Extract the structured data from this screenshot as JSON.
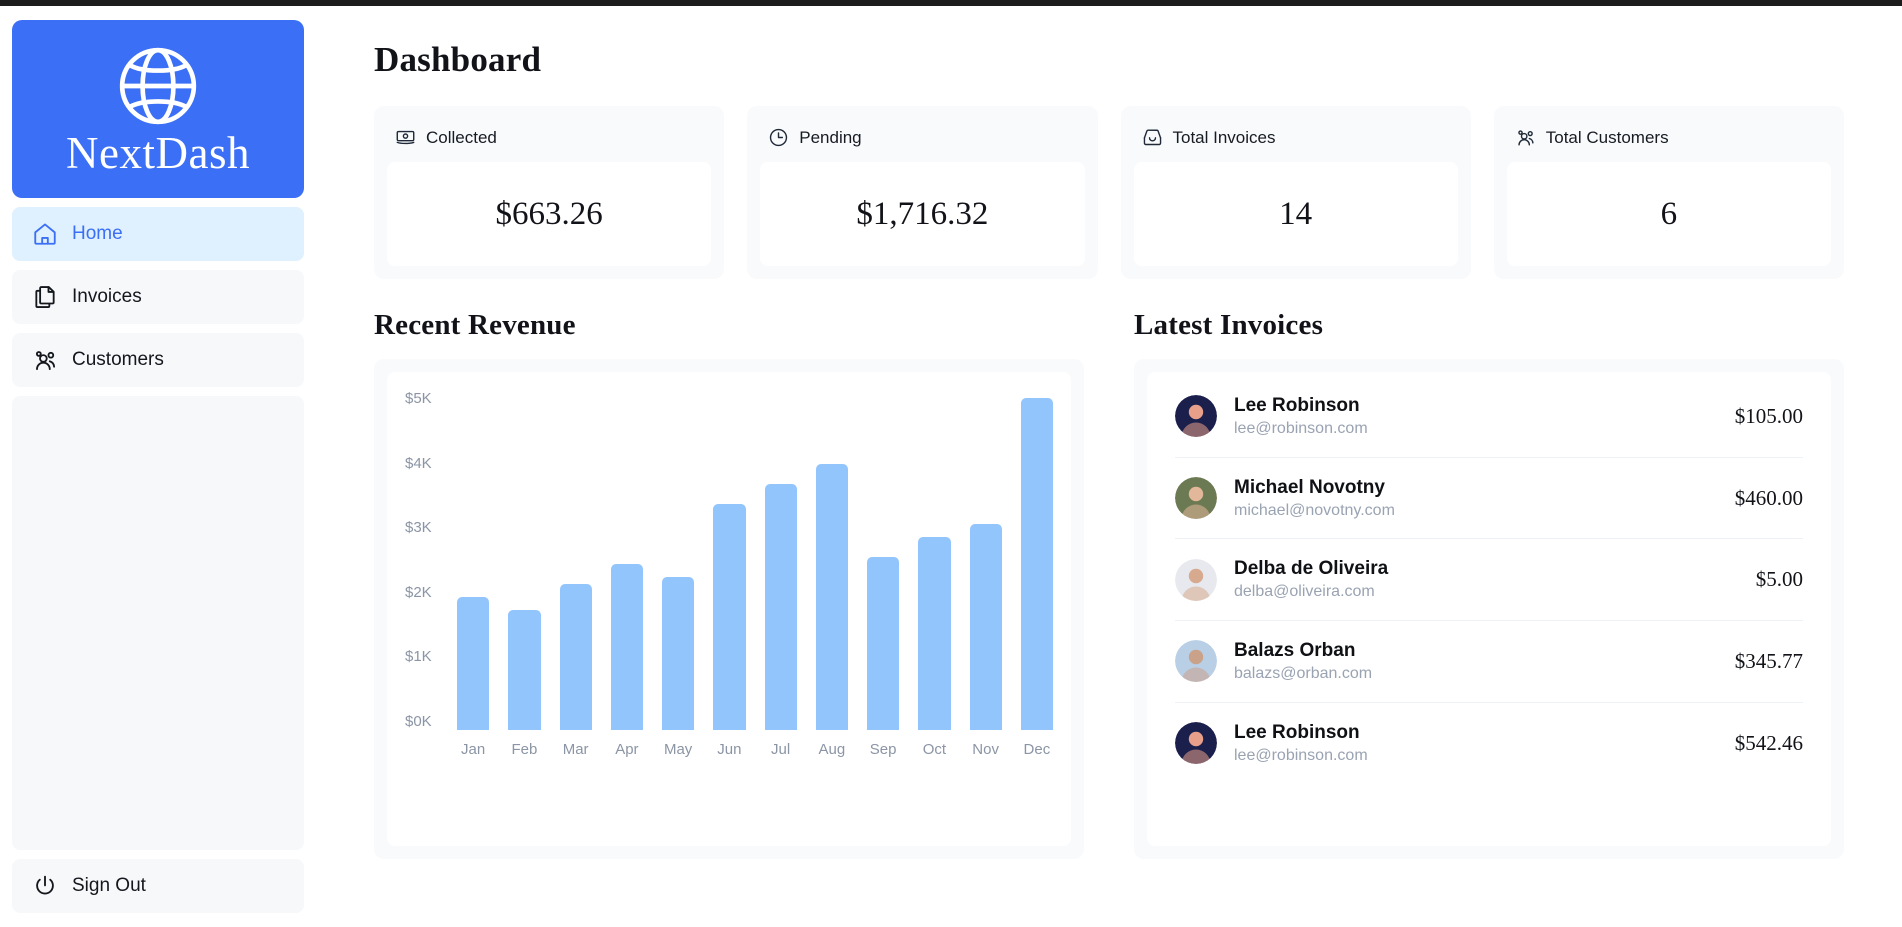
{
  "sidebar": {
    "brand": "NextDash",
    "brand_icon": "globe-icon",
    "nav": [
      {
        "label": "Home",
        "icon": "home-icon",
        "active": true
      },
      {
        "label": "Invoices",
        "icon": "documents-icon",
        "active": false
      },
      {
        "label": "Customers",
        "icon": "users-icon",
        "active": false
      }
    ],
    "sign_out": {
      "label": "Sign Out",
      "icon": "power-icon"
    }
  },
  "main": {
    "page_title": "Dashboard",
    "cards": [
      {
        "label": "Collected",
        "value": "$663.26",
        "icon": "banknote-icon"
      },
      {
        "label": "Pending",
        "value": "$1,716.32",
        "icon": "clock-icon"
      },
      {
        "label": "Total Invoices",
        "value": "14",
        "icon": "inbox-icon"
      },
      {
        "label": "Total Customers",
        "value": "6",
        "icon": "users-icon"
      }
    ],
    "revenue_heading": "Recent Revenue",
    "invoices_heading": "Latest Invoices",
    "invoices": [
      {
        "name": "Lee Robinson",
        "email": "lee@robinson.com",
        "amount": "$105.00",
        "avatar_bg": "#1b1f4b",
        "avatar_skin": "#e8a08a"
      },
      {
        "name": "Michael Novotny",
        "email": "michael@novotny.com",
        "amount": "$460.00",
        "avatar_bg": "#6b7a52",
        "avatar_skin": "#e3b79a"
      },
      {
        "name": "Delba de Oliveira",
        "email": "delba@oliveira.com",
        "amount": "$5.00",
        "avatar_bg": "#e7e9ee",
        "avatar_skin": "#d7a98e"
      },
      {
        "name": "Balazs Orban",
        "email": "balazs@orban.com",
        "amount": "$345.77",
        "avatar_bg": "#b9cfe6",
        "avatar_skin": "#caa189"
      },
      {
        "name": "Lee Robinson",
        "email": "lee@robinson.com",
        "amount": "$542.46",
        "avatar_bg": "#1b1f4b",
        "avatar_skin": "#e8a08a"
      }
    ]
  },
  "colors": {
    "brand_blue": "#3b6ff6",
    "bar_blue": "#93c5fd",
    "panel_gray": "#f8fafc",
    "active_nav_bg": "#dff0fe"
  },
  "chart_data": {
    "type": "bar",
    "title": "Recent Revenue",
    "xlabel": "",
    "ylabel": "",
    "ylim": [
      0,
      5000
    ],
    "yticks": [
      0,
      1000,
      2000,
      3000,
      4000,
      5000
    ],
    "ytick_labels": [
      "$0K",
      "$1K",
      "$2K",
      "$3K",
      "$4K",
      "$5K"
    ],
    "grid": false,
    "legend": "none",
    "categories": [
      "Jan",
      "Feb",
      "Mar",
      "Apr",
      "May",
      "Jun",
      "Jul",
      "Aug",
      "Sep",
      "Oct",
      "Nov",
      "Dec"
    ],
    "values": [
      2000,
      1800,
      2200,
      2500,
      2300,
      3400,
      3700,
      4000,
      2600,
      2900,
      3100,
      5000
    ]
  }
}
